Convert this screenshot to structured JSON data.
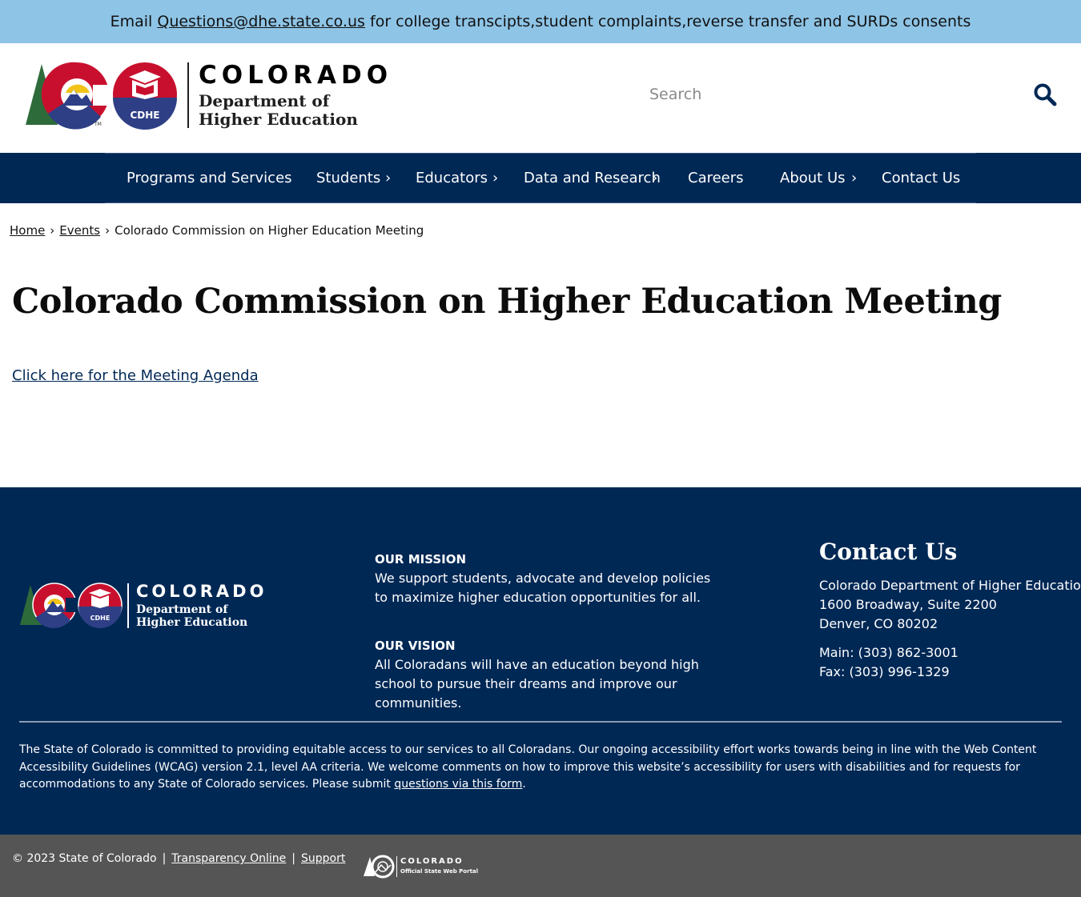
{
  "alert": {
    "prefix": "Email ",
    "email": "Questions@dhe.state.co.us",
    "suffix": " for college transcipts,student complaints,reverse transfer and SURDs consents"
  },
  "header": {
    "logo_colorado": "COLORADO",
    "logo_dept_line1": "Department of",
    "logo_dept_line2": "Higher Education",
    "logo_badge": "CDHE",
    "logo_tm": "TM",
    "search_placeholder": "Search"
  },
  "nav": {
    "items": [
      {
        "label": "Programs and Services",
        "has_submenu": false
      },
      {
        "label": "Students",
        "has_submenu": true
      },
      {
        "label": "Educators",
        "has_submenu": true
      },
      {
        "label": "Data and Research",
        "has_submenu": true
      },
      {
        "label": "Careers",
        "has_submenu": false
      },
      {
        "label": "About Us",
        "has_submenu": true
      },
      {
        "label": "Contact Us",
        "has_submenu": false
      }
    ],
    "submenu_glyph": "›"
  },
  "breadcrumb": {
    "items": [
      "Home",
      "Events",
      "Colorado Commission on Higher Education Meeting"
    ],
    "separator": "›"
  },
  "main": {
    "title": "Colorado Commission on Higher Education Meeting",
    "agenda_link": "Click here for the Meeting Agenda"
  },
  "footer": {
    "logo_colorado": "COLORADO",
    "logo_dept_line1": "Department of",
    "logo_dept_line2": "Higher Education",
    "logo_badge": "CDHE",
    "mission_heading": "OUR MISSION",
    "mission_text": "We support students, advocate and develop policies to maximize higher education opportunities for all.",
    "vision_heading": "OUR VISION",
    "vision_text": "All Coloradans will have an education beyond high school to pursue their dreams and improve our communities.",
    "contact_heading": "Contact Us",
    "contact_org": "Colorado Department of Higher Education",
    "contact_street": "1600 Broadway, Suite 2200",
    "contact_city": "Denver, CO 80202",
    "contact_main": "Main: (303) 862-3001",
    "contact_fax": "Fax: (303) 996-1329",
    "a11y_text": "The State of Colorado is committed to providing equitable access to our services to all Coloradans. Our ongoing accessibility effort works towards being in line with the Web Content Accessibility Guidelines (WCAG) version 2.1, level AA criteria. We welcome comments on how to improve this website’s accessibility for users with disabilities and for requests for accommodations to any State of Colorado services. Please submit ",
    "a11y_link": "questions via this form",
    "a11y_end": "."
  },
  "bottom": {
    "copyright": "© 2023 State of Colorado",
    "pipe": "|",
    "transparency": "Transparency Online",
    "support": "Support",
    "portal_title": "COLORADO",
    "portal_sub": "Official State Web Portal"
  },
  "colors": {
    "alert_bg": "#8ec4e6",
    "navy": "#002855",
    "bottom_bg": "#555555",
    "logo_red": "#c8102e",
    "logo_blue": "#2e3f86",
    "logo_green": "#2e6b3a",
    "logo_gold": "#f2c318"
  }
}
